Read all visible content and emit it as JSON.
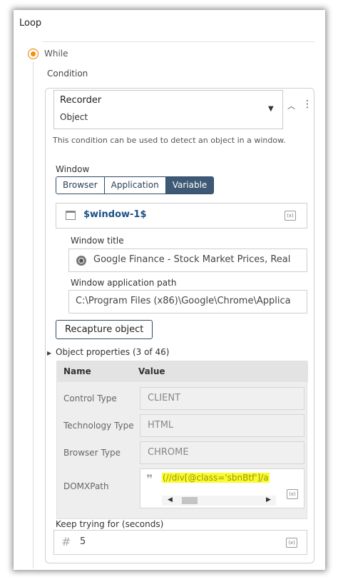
{
  "loop": {
    "title": "Loop"
  },
  "while": {
    "label": "While"
  },
  "condition": {
    "label": "Condition",
    "type": "Recorder",
    "subtype": "Object",
    "hint": "This condition can be used to detect an object in a window."
  },
  "window": {
    "label": "Window",
    "tabs": [
      "Browser",
      "Application",
      "Variable"
    ],
    "active_tab": "Variable",
    "variable_value": "$window-1$",
    "title_label": "Window title",
    "title_value": "Google Finance - Stock Market Prices, Real",
    "path_label": "Window application path",
    "path_value": "C:\\Program Files (x86)\\Google\\Chrome\\Applica"
  },
  "recapture_label": "Recapture object",
  "object_properties": {
    "label": "Object properties (3 of 46)",
    "headers": {
      "name": "Name",
      "value": "Value"
    },
    "rows": [
      {
        "name": "Control Type",
        "value": "CLIENT"
      },
      {
        "name": "Technology Type",
        "value": "HTML"
      },
      {
        "name": "Browser Type",
        "value": "CHROME"
      },
      {
        "name": "DOMXPath",
        "value": "(//div[@class='sbnBtf']/a"
      }
    ]
  },
  "keep_trying": {
    "label": "Keep trying for (seconds)",
    "value": "5"
  },
  "fx_label": "(x)",
  "icons": [
    "radio-selected-icon",
    "dropdown-arrow-icon",
    "chevron-up-icon",
    "kebab-menu-icon",
    "window-icon",
    "variable-fx-icon",
    "chrome-icon",
    "expand-arrow-icon",
    "quote-icon",
    "hash-icon"
  ],
  "colors": {
    "accent": "#f39200",
    "active_tab": "#3d5975",
    "variable_text": "#1b4f87",
    "highlight": "#fafa33"
  }
}
